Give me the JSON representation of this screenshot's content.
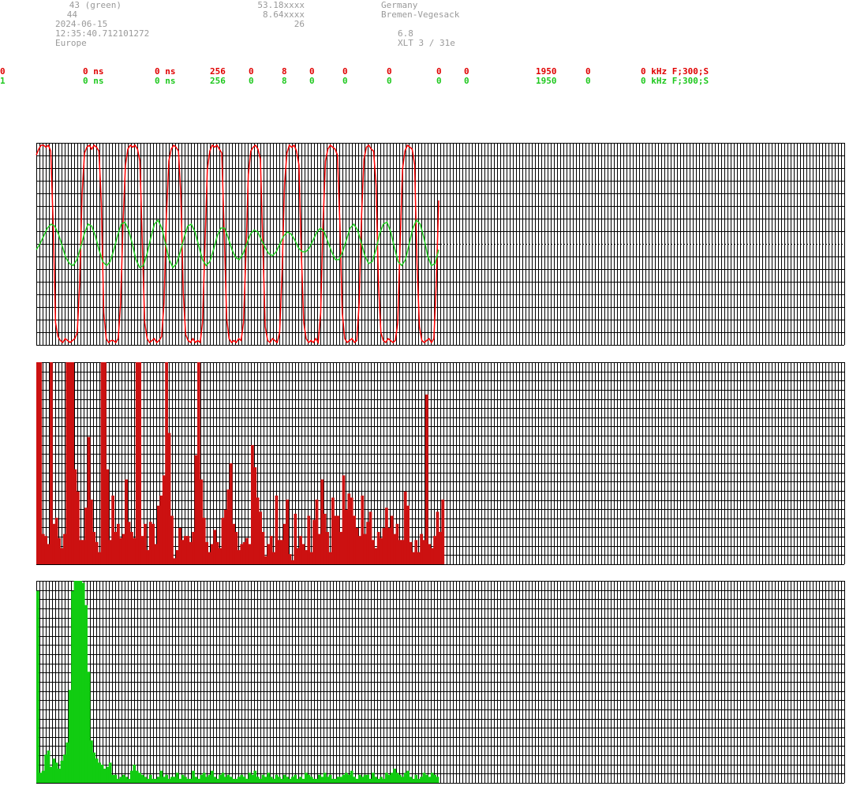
{
  "header": {
    "left_line1": "43 (green)",
    "left_line2": "44",
    "date": "2024-06-15",
    "time": "12:35:40.712101272",
    "region": "Europe",
    "lat": "53.18xxxx",
    "lon": "8.64xxxx",
    "value_26": "26",
    "country": "Germany",
    "city": "Bremen-Vegesack",
    "version": "6.8",
    "xlt": "XLT 3 / 31e"
  },
  "channels": [
    {
      "ch": "0",
      "delay1": "0 ns",
      "delay2": "0 ns",
      "n": "256",
      "a": "0",
      "b": "8",
      "c": "0",
      "d": "0",
      "e": "0",
      "f": "0",
      "g": "0",
      "freq": "1950",
      "h": "0",
      "tail": "0 kHz F;300;S",
      "color": "#e00000"
    },
    {
      "ch": "1",
      "delay1": "0 ns",
      "delay2": "0 ns",
      "n": "256",
      "a": "0",
      "b": "8",
      "c": "0",
      "d": "0",
      "e": "0",
      "f": "0",
      "g": "0",
      "freq": "1950",
      "h": "0",
      "tail": "0 kHz F;300;S",
      "color": "#1ec81e"
    }
  ],
  "chart_data": [
    {
      "type": "line",
      "series": [
        {
          "color": "#ff0000",
          "values": [
            0.95,
            0.98,
            1.0,
            1.0,
            0.99,
            1.0,
            0.97,
            0.6,
            0.1,
            0.03,
            0.01,
            0.0,
            0.02,
            0.01,
            0.0,
            0.01,
            0.02,
            0.05,
            0.3,
            0.75,
            0.96,
            0.99,
            1.0,
            0.98,
            1.0,
            0.99,
            0.97,
            0.7,
            0.15,
            0.02,
            0.0,
            0.01,
            0.01,
            0.0,
            0.02,
            0.2,
            0.6,
            0.9,
            0.98,
            1.0,
            0.99,
            1.0,
            0.98,
            0.92,
            0.5,
            0.1,
            0.02,
            0.0,
            0.01,
            0.02,
            0.0,
            0.01,
            0.03,
            0.2,
            0.65,
            0.92,
            0.98,
            1.0,
            0.99,
            0.97,
            0.75,
            0.25,
            0.04,
            0.01,
            0.0,
            0.02,
            0.0,
            0.01,
            0.0,
            0.1,
            0.5,
            0.88,
            0.97,
            1.0,
            0.99,
            1.0,
            0.98,
            0.96,
            0.55,
            0.12,
            0.02,
            0.0,
            0.01,
            0.0,
            0.02,
            0.01,
            0.1,
            0.45,
            0.85,
            0.97,
            0.99,
            1.0,
            0.98,
            0.93,
            0.5,
            0.08,
            0.01,
            0.0,
            0.02,
            0.01,
            0.0,
            0.05,
            0.35,
            0.8,
            0.96,
            1.0,
            0.99,
            1.0,
            0.97,
            0.9,
            0.45,
            0.1,
            0.02,
            0.0,
            0.01,
            0.0,
            0.02,
            0.0,
            0.15,
            0.6,
            0.92,
            0.98,
            1.0,
            0.99,
            0.98,
            0.95,
            0.6,
            0.15,
            0.02,
            0.0,
            0.01,
            0.02,
            0.0,
            0.01,
            0.2,
            0.65,
            0.93,
            0.99,
            1.0,
            0.98,
            0.97,
            0.8,
            0.3,
            0.05,
            0.01,
            0.0,
            0.02,
            0.01,
            0.0,
            0.01,
            0.1,
            0.5,
            0.88,
            0.97,
            1.0,
            0.99,
            0.98,
            0.9,
            0.4,
            0.08,
            0.01,
            0.0,
            0.01,
            0.02,
            0.0,
            0.02,
            0.3,
            0.72
          ]
        },
        {
          "color": "#22cc22",
          "values": [
            0.47,
            0.5,
            0.54,
            0.58,
            0.6,
            0.59,
            0.55,
            0.49,
            0.43,
            0.4,
            0.39,
            0.42,
            0.48,
            0.55,
            0.6,
            0.59,
            0.54,
            0.47,
            0.41,
            0.39,
            0.41,
            0.47,
            0.54,
            0.6,
            0.61,
            0.57,
            0.5,
            0.42,
            0.38,
            0.39,
            0.45,
            0.53,
            0.6,
            0.62,
            0.58,
            0.5,
            0.42,
            0.38,
            0.4,
            0.46,
            0.53,
            0.59,
            0.6,
            0.56,
            0.49,
            0.42,
            0.39,
            0.41,
            0.47,
            0.54,
            0.58,
            0.58,
            0.53,
            0.47,
            0.43,
            0.42,
            0.45,
            0.5,
            0.55,
            0.57,
            0.56,
            0.52,
            0.48,
            0.45,
            0.44,
            0.46,
            0.5,
            0.54,
            0.56,
            0.55,
            0.52,
            0.48,
            0.46,
            0.46,
            0.48,
            0.52,
            0.56,
            0.58,
            0.56,
            0.51,
            0.46,
            0.42,
            0.42,
            0.46,
            0.52,
            0.58,
            0.6,
            0.57,
            0.51,
            0.44,
            0.4,
            0.41,
            0.47,
            0.55,
            0.6,
            0.61,
            0.56,
            0.48,
            0.41,
            0.39,
            0.42,
            0.5,
            0.58,
            0.62,
            0.6,
            0.53,
            0.44,
            0.39,
            0.4,
            0.47
          ]
        }
      ],
      "ylim": [
        0,
        1
      ],
      "grid": true
    },
    {
      "type": "bar",
      "color": "#cc1111",
      "values": [
        1.0,
        1.0,
        0.15,
        0.14,
        0.1,
        1.0,
        0.2,
        0.23,
        0.13,
        0.08,
        0.15,
        1.0,
        1.0,
        1.0,
        0.47,
        0.36,
        0.12,
        0.12,
        0.28,
        0.63,
        0.32,
        0.16,
        0.11,
        0.06,
        1.0,
        1.0,
        0.47,
        0.12,
        0.34,
        0.16,
        0.2,
        0.13,
        0.15,
        0.42,
        0.21,
        0.16,
        0.13,
        1.0,
        1.0,
        0.14,
        0.2,
        0.07,
        0.21,
        0.2,
        0.1,
        0.29,
        0.34,
        0.44,
        1.0,
        0.65,
        0.24,
        0.03,
        0.07,
        0.18,
        0.12,
        0.14,
        0.14,
        0.11,
        0.16,
        0.54,
        1.0,
        0.42,
        0.23,
        0.11,
        0.06,
        0.1,
        0.17,
        0.11,
        0.08,
        0.23,
        0.27,
        0.37,
        0.5,
        0.2,
        0.16,
        0.07,
        0.1,
        0.11,
        0.13,
        0.1,
        0.59,
        0.48,
        0.33,
        0.26,
        0.16,
        0.04,
        0.1,
        0.14,
        0.06,
        0.34,
        0.12,
        0.12,
        0.2,
        0.32,
        0.05,
        0.02,
        0.25,
        0.08,
        0.14,
        0.1,
        0.07,
        0.24,
        0.06,
        0.22,
        0.32,
        0.15,
        0.42,
        0.25,
        0.16,
        0.06,
        0.33,
        0.24,
        0.24,
        0.16,
        0.44,
        0.27,
        0.35,
        0.33,
        0.24,
        0.18,
        0.14,
        0.34,
        0.15,
        0.21,
        0.26,
        0.12,
        0.08,
        0.16,
        0.13,
        0.18,
        0.28,
        0.18,
        0.24,
        0.15,
        0.2,
        0.12,
        0.12,
        0.36,
        0.29,
        0.11,
        0.06,
        0.12,
        0.06,
        0.15,
        0.12,
        0.84,
        0.1,
        0.08,
        0.14,
        0.26,
        0.16,
        0.32
      ]
    },
    {
      "type": "bar",
      "color": "#11cc11",
      "values": [
        0.95,
        0.05,
        0.06,
        0.14,
        0.16,
        0.08,
        0.12,
        0.1,
        0.07,
        0.11,
        0.14,
        0.2,
        0.46,
        0.95,
        1.0,
        1.0,
        1.0,
        0.99,
        0.88,
        0.55,
        0.21,
        0.15,
        0.12,
        0.1,
        0.09,
        0.07,
        0.08,
        0.1,
        0.04,
        0.04,
        0.02,
        0.03,
        0.04,
        0.03,
        0.02,
        0.06,
        0.09,
        0.06,
        0.05,
        0.04,
        0.03,
        0.02,
        0.04,
        0.02,
        0.02,
        0.03,
        0.06,
        0.03,
        0.04,
        0.02,
        0.03,
        0.03,
        0.05,
        0.02,
        0.04,
        0.03,
        0.02,
        0.02,
        0.06,
        0.03,
        0.02,
        0.04,
        0.05,
        0.03,
        0.04,
        0.06,
        0.03,
        0.02,
        0.04,
        0.05,
        0.03,
        0.04,
        0.03,
        0.02,
        0.02,
        0.03,
        0.04,
        0.03,
        0.02,
        0.05,
        0.04,
        0.06,
        0.03,
        0.02,
        0.04,
        0.03,
        0.05,
        0.03,
        0.02,
        0.04,
        0.03,
        0.02,
        0.04,
        0.03,
        0.02,
        0.03,
        0.04,
        0.02,
        0.03,
        0.02,
        0.05,
        0.04,
        0.03,
        0.02,
        0.02,
        0.04,
        0.03,
        0.05,
        0.03,
        0.04,
        0.02,
        0.02,
        0.03,
        0.03,
        0.04,
        0.05,
        0.04,
        0.06,
        0.03,
        0.02,
        0.04,
        0.03,
        0.04,
        0.04,
        0.02,
        0.05,
        0.03,
        0.02,
        0.03,
        0.02,
        0.05,
        0.04,
        0.05,
        0.07,
        0.05,
        0.04,
        0.03,
        0.05,
        0.06,
        0.03,
        0.02,
        0.04,
        0.02,
        0.03,
        0.05,
        0.04,
        0.03,
        0.05,
        0.04,
        0.03
      ]
    }
  ]
}
